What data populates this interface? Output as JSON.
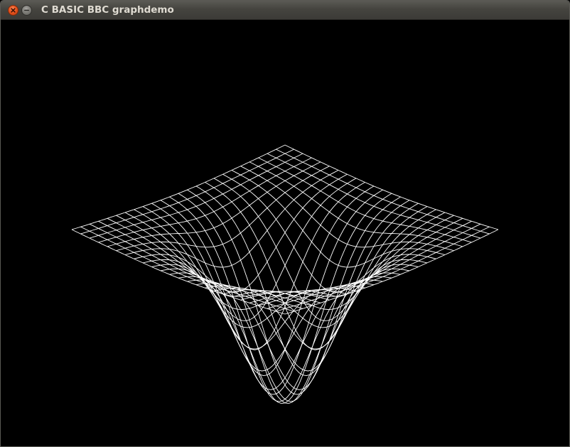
{
  "window": {
    "title": "C BASIC BBC graphdemo"
  },
  "titlebar_buttons": [
    {
      "name": "close",
      "icon": "close-icon",
      "color": "#e9541e"
    },
    {
      "name": "minimize",
      "icon": "minimize-icon",
      "color": "#7c7b76"
    }
  ],
  "colors": {
    "background": "#000000",
    "wireframe": "#ffffff",
    "titlebar": "#3c3b37",
    "title_text": "#dfdbd2"
  },
  "plot": {
    "type": "3d-wireframe-surface",
    "surface": "bowl-shaped depression (inverted Gaussian) over a square grid",
    "grid_lines_per_axis": 25
  }
}
